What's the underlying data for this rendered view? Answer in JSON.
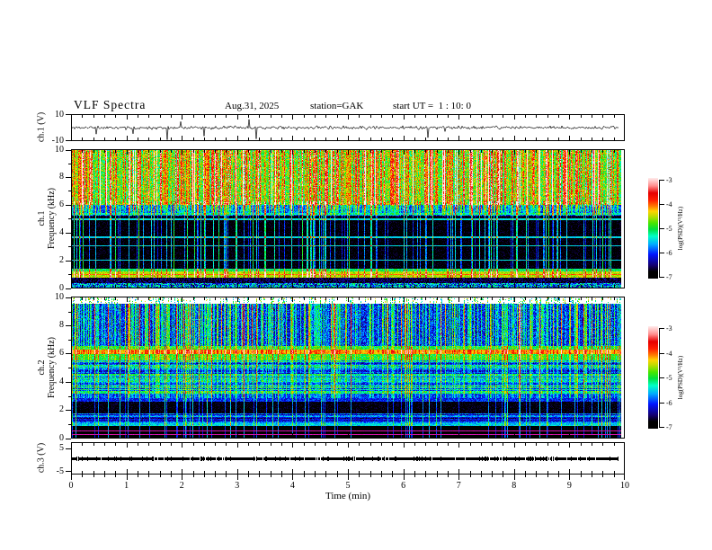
{
  "header": {
    "title": "VLF Spectra",
    "date": "Aug.31, 2025",
    "station": "station=GAK",
    "start_ut": "start UT =  1 : 10: 0"
  },
  "panels": {
    "ch1_wave": {
      "ylabel": "ch.1 (V)",
      "ymax": "10",
      "ymin": "-10"
    },
    "ch1_spec": {
      "ylabel_line1": "ch.1",
      "ylabel_line2": "Frequency (kHz)",
      "yticks": [
        "10",
        "8",
        "6",
        "4",
        "2",
        "0"
      ]
    },
    "ch2_spec": {
      "ylabel_line1": "ch.2",
      "ylabel_line2": "Frequency (kHz)",
      "yticks": [
        "10",
        "8",
        "6",
        "4",
        "2",
        "0"
      ]
    },
    "ch3_wave": {
      "ylabel": "ch.3 (V)",
      "ymax": "5",
      "ymin": "-5"
    }
  },
  "xaxis": {
    "label": "Time (min)",
    "ticks": [
      "0",
      "1",
      "2",
      "3",
      "4",
      "5",
      "6",
      "7",
      "8",
      "9",
      "10"
    ]
  },
  "colorbar": {
    "label": "log(PSD)(V²/Hz)",
    "ticks": [
      "-3",
      "-4",
      "-5",
      "-6",
      "-7"
    ]
  },
  "chart_data": [
    {
      "panel": "ch1_waveform",
      "type": "line",
      "xlabel": "Time (min)",
      "x_range_min": [
        0,
        10
      ],
      "ylabel": "ch.1 (V)",
      "y_range_V": [
        -10,
        10
      ],
      "yticks_V": [
        10,
        -10
      ],
      "description": "Broadband noise waveform centered on 0 V, ~±1 V background, impulsive sferic spikes mostly downward to about -9 V and upward to about +7 V",
      "render": {
        "seed": 11,
        "noise_V": 0.55,
        "spike_down_prob": 0.013,
        "spike_up_prob": 0.005,
        "spike_down_V": [
          2.5,
          9.5
        ],
        "spike_up_V": [
          2.5,
          8
        ]
      }
    },
    {
      "panel": "ch1_spectrogram",
      "type": "heatmap",
      "x_range_min": [
        0,
        10
      ],
      "y_range_kHz": [
        0,
        10
      ],
      "z_range_logPSD": [
        -7,
        -3
      ],
      "z_label": "log(PSD)(V²/Hz)",
      "yticks_kHz": [
        0,
        2,
        4,
        6,
        8,
        10
      ],
      "features": [
        "5.5-10 kHz: continuous green hiss band near -5 with dense vertical sferic streaks reaching yellow/red (-4 to -3.5)",
        "1.4-5.2 kHz: dark background near -6.8 crossed by cyan/green vertical sferics and thin cyan horizontal lines near 2.0, 3.05, 3.65, 4.95, 5.35 kHz",
        "0.75-1.15 kHz: bright yellow-green band near -4.6 with an orange-red line at ~0.95 kHz",
        "0-0.75 kHz: dark with cyan speckle near 0 kHz"
      ],
      "render": {
        "ch": 1,
        "seed": 21,
        "bands": [
          [
            6,
            10,
            -5.0,
            1.0
          ],
          [
            5.2,
            6,
            -5.9,
            0.9
          ],
          [
            1.35,
            5.2,
            -6.8,
            0.5
          ],
          [
            1.15,
            1.35,
            -5.2,
            0.6
          ],
          [
            0.75,
            1.15,
            -4.55,
            0.5
          ],
          [
            0.35,
            0.75,
            -6.6,
            0.8
          ],
          [
            0,
            0.35,
            -5.7,
            1.6
          ]
        ],
        "hlines": [
          [
            0.95,
            -4.05
          ],
          [
            1.28,
            -5.0
          ],
          [
            2.0,
            -5.5
          ],
          [
            3.05,
            -5.5
          ],
          [
            3.65,
            -5.5
          ],
          [
            4.95,
            -5.45
          ],
          [
            5.35,
            -5.45
          ]
        ]
      }
    },
    {
      "panel": "ch2_spectrogram",
      "type": "heatmap",
      "x_range_min": [
        0,
        10
      ],
      "y_range_kHz": [
        0,
        10
      ],
      "z_range_logPSD": [
        -7,
        -3
      ],
      "z_label": "log(PSD)(V²/Hz)",
      "yticks_kHz": [
        0,
        2,
        4,
        6,
        8,
        10
      ],
      "features": [
        "9.6-10 kHz: mostly blank (white) with sparse colored columns",
        "6.6-9.6 kHz: blue background ~-6.2 with dense cyan/green vertical streaks",
        "6.0-6.3 kHz: persistent bright yellow band ~-4.3 with orange patches",
        "3.0-5.5 kHz: horizontal cyan/green striations on blue ~-5.8",
        "1.75-2.55 kHz: very dark band ~-6.8",
        "0-0.85 kHz: near-black with thin magenta lines near 0.5 and 0.2 kHz"
      ],
      "render": {
        "ch": 2,
        "seed": 33,
        "white_above_kHz": 9.58,
        "bands": [
          [
            9.58,
            10,
            -7.2,
            0.4
          ],
          [
            6.55,
            9.58,
            -6.15,
            0.9
          ],
          [
            6.3,
            6.55,
            -5.15,
            0.6
          ],
          [
            5.95,
            6.3,
            -4.35,
            0.5
          ],
          [
            5.5,
            5.95,
            -5.1,
            0.6
          ],
          [
            3.0,
            5.5,
            -5.8,
            0.7,
            1
          ],
          [
            2.55,
            3.0,
            -6.05,
            0.6
          ],
          [
            1.75,
            2.55,
            -6.75,
            0.4
          ],
          [
            1.05,
            1.75,
            -6.0,
            0.6,
            1
          ],
          [
            0.85,
            1.05,
            -5.5,
            0.6
          ],
          [
            0,
            0.85,
            -6.85,
            0.3
          ]
        ],
        "hlines": [],
        "magenta_lines_kHz": [
          0.5,
          0.2
        ]
      }
    },
    {
      "panel": "ch3_waveform",
      "type": "line",
      "x_range_min": [
        0,
        10
      ],
      "ylabel": "ch.3 (V)",
      "y_range_V": [
        -5,
        5
      ],
      "yticks_V": [
        5,
        -5
      ],
      "description": "Constant 0 V thick black trace (channel flat/off) across the full 10 minutes",
      "render": {
        "seed": 44
      }
    }
  ]
}
